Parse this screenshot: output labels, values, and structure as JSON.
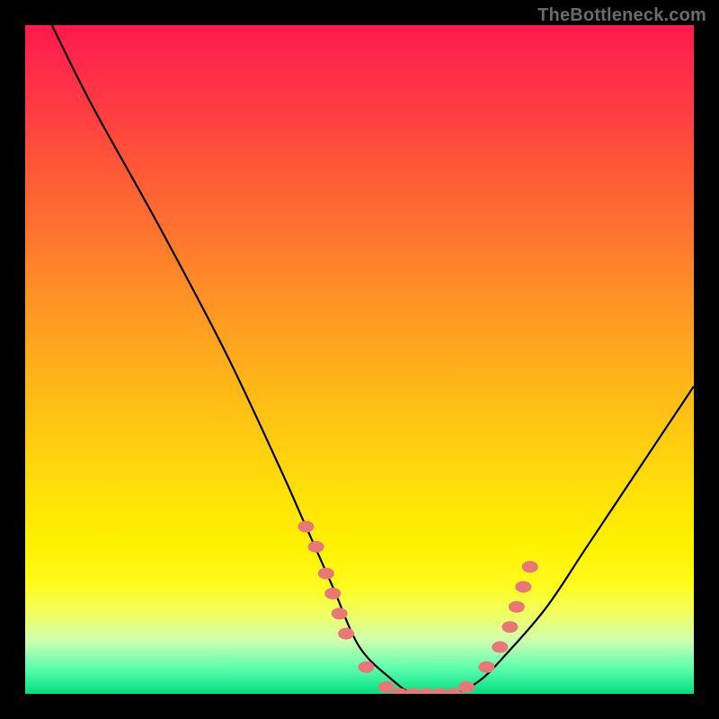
{
  "watermark": "TheBottleneck.com",
  "chart_data": {
    "type": "line",
    "title": "",
    "xlabel": "",
    "ylabel": "",
    "xlim": [
      0,
      100
    ],
    "ylim": [
      0,
      100
    ],
    "series": [
      {
        "name": "curve",
        "x": [
          4,
          10,
          20,
          30,
          38,
          42,
          46,
          50,
          55,
          58,
          61,
          64,
          68,
          72,
          78,
          84,
          90,
          96,
          100
        ],
        "y": [
          100,
          88,
          70,
          51,
          34,
          25,
          16,
          7,
          2,
          0,
          0,
          0,
          2,
          6,
          13,
          22,
          31,
          40,
          46
        ]
      }
    ],
    "highlight_points": [
      {
        "x": 42,
        "y": 25
      },
      {
        "x": 43.5,
        "y": 22
      },
      {
        "x": 45,
        "y": 18
      },
      {
        "x": 46,
        "y": 15
      },
      {
        "x": 47,
        "y": 12
      },
      {
        "x": 48,
        "y": 9
      },
      {
        "x": 51,
        "y": 4
      },
      {
        "x": 54,
        "y": 1
      },
      {
        "x": 56,
        "y": 0
      },
      {
        "x": 58,
        "y": 0
      },
      {
        "x": 60,
        "y": 0
      },
      {
        "x": 62,
        "y": 0
      },
      {
        "x": 64,
        "y": 0
      },
      {
        "x": 66,
        "y": 1
      },
      {
        "x": 69,
        "y": 4
      },
      {
        "x": 71,
        "y": 7
      },
      {
        "x": 72.5,
        "y": 10
      },
      {
        "x": 73.5,
        "y": 13
      },
      {
        "x": 74.5,
        "y": 16
      },
      {
        "x": 75.5,
        "y": 19
      }
    ],
    "highlight_color": "#e87878",
    "curve_color": "#000000"
  }
}
